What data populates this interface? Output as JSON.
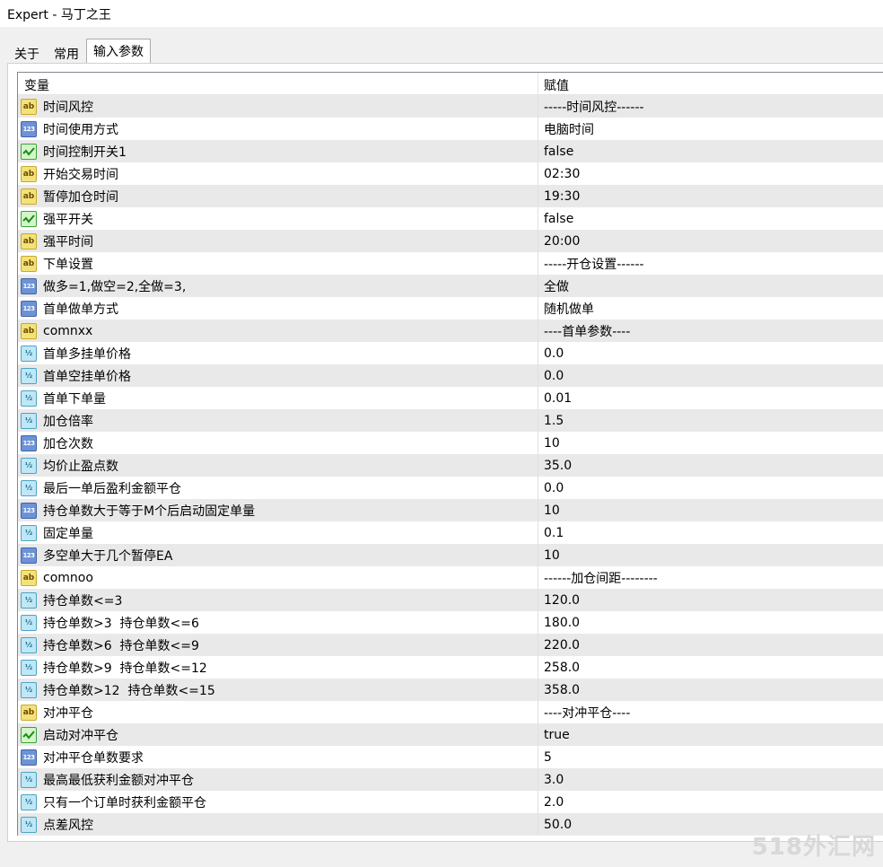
{
  "window": {
    "title": "Expert - 马丁之王"
  },
  "tabs": [
    {
      "label": "关于",
      "active": false
    },
    {
      "label": "常用",
      "active": false
    },
    {
      "label": "输入参数",
      "active": true
    }
  ],
  "table": {
    "headers": {
      "variable": "变量",
      "value": "赋值"
    },
    "rows": [
      {
        "icon": "ab",
        "name": "时间风控",
        "value": "-----时间风控------"
      },
      {
        "icon": "123",
        "name": "时间使用方式",
        "value": "电脑时间"
      },
      {
        "icon": "bool",
        "name": "时间控制开关1",
        "value": "false"
      },
      {
        "icon": "ab",
        "name": "开始交易时间",
        "value": "02:30"
      },
      {
        "icon": "ab",
        "name": "暂停加仓时间",
        "value": "19:30"
      },
      {
        "icon": "bool",
        "name": "强平开关",
        "value": "false"
      },
      {
        "icon": "ab",
        "name": "强平时间",
        "value": "20:00"
      },
      {
        "icon": "ab",
        "name": "下单设置",
        "value": "-----开仓设置------"
      },
      {
        "icon": "123",
        "name": "做多=1,做空=2,全做=3,",
        "value": "全做"
      },
      {
        "icon": "123",
        "name": "首单做单方式",
        "value": "随机做单"
      },
      {
        "icon": "ab",
        "name": "comnxx",
        "value": "----首单参数----"
      },
      {
        "icon": "half",
        "name": "首单多挂单价格",
        "value": "0.0"
      },
      {
        "icon": "half",
        "name": "首单空挂单价格",
        "value": "0.0"
      },
      {
        "icon": "half",
        "name": "首单下单量",
        "value": "0.01"
      },
      {
        "icon": "half",
        "name": "加仓倍率",
        "value": "1.5"
      },
      {
        "icon": "123",
        "name": "加仓次数",
        "value": "10"
      },
      {
        "icon": "half",
        "name": "均价止盈点数",
        "value": "35.0"
      },
      {
        "icon": "half",
        "name": "最后一单后盈利金额平仓",
        "value": "0.0"
      },
      {
        "icon": "123",
        "name": "持仓单数大于等于M个后启动固定单量",
        "value": "10"
      },
      {
        "icon": "half",
        "name": "固定单量",
        "value": "0.1"
      },
      {
        "icon": "123",
        "name": "多空单大于几个暂停EA",
        "value": "10"
      },
      {
        "icon": "ab",
        "name": "comnoo",
        "value": "------加仓间距--------"
      },
      {
        "icon": "half",
        "name": "持仓单数<=3",
        "value": "120.0"
      },
      {
        "icon": "half",
        "name": "持仓单数>3  持仓单数<=6",
        "value": "180.0"
      },
      {
        "icon": "half",
        "name": "持仓单数>6  持仓单数<=9",
        "value": "220.0"
      },
      {
        "icon": "half",
        "name": "持仓单数>9  持仓单数<=12",
        "value": "258.0"
      },
      {
        "icon": "half",
        "name": "持仓单数>12  持仓单数<=15",
        "value": "358.0"
      },
      {
        "icon": "ab",
        "name": "对冲平仓",
        "value": "----对冲平仓----"
      },
      {
        "icon": "bool",
        "name": "启动对冲平仓",
        "value": "true"
      },
      {
        "icon": "123",
        "name": "对冲平仓单数要求",
        "value": "5"
      },
      {
        "icon": "half",
        "name": "最高最低获利金额对冲平仓",
        "value": "3.0"
      },
      {
        "icon": "half",
        "name": "只有一个订单时获利金额平仓",
        "value": "2.0"
      },
      {
        "icon": "half",
        "name": "点差风控",
        "value": "50.0"
      }
    ]
  },
  "icon_labels": {
    "ab": "ab",
    "123": "123",
    "half": "½"
  },
  "watermark": "518外汇网"
}
